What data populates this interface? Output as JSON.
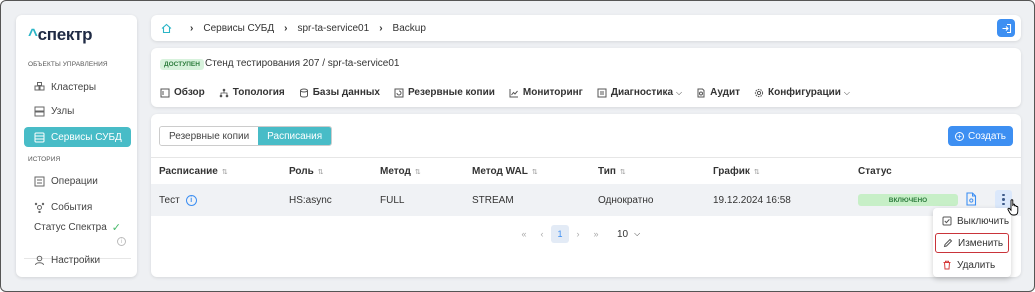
{
  "sidebar": {
    "logo_caret": "^",
    "logo_text": "спектр",
    "section_objects": "ОБЪЕКТЫ УПРАВЛЕНИЯ",
    "items": [
      {
        "label": "Кластеры",
        "icon": "cluster-icon"
      },
      {
        "label": "Узлы",
        "icon": "server-icon"
      },
      {
        "label": "Сервисы СУБД",
        "icon": "database-service-icon",
        "active": true
      }
    ],
    "section_history": "ИСТОРИЯ",
    "history_items": [
      {
        "label": "Операции",
        "icon": "operations-icon"
      },
      {
        "label": "События",
        "icon": "events-icon"
      }
    ],
    "status_label": "Статус Спектра",
    "settings_label": "Настройки"
  },
  "breadcrumb": {
    "items": [
      "Сервисы СУБД",
      "spr-ta-service01",
      "Backup"
    ]
  },
  "header": {
    "badge": "ДОСТУПЕН",
    "title": "Стенд тестирования 207 / spr-ta-service01",
    "tabs": [
      {
        "label": "Обзор",
        "icon": "overview-icon"
      },
      {
        "label": "Топология",
        "icon": "topology-icon"
      },
      {
        "label": "Базы данных",
        "icon": "database-icon"
      },
      {
        "label": "Резервные копии",
        "icon": "backup-icon"
      },
      {
        "label": "Мониторинг",
        "icon": "monitoring-icon"
      },
      {
        "label": "Диагностика",
        "icon": "diagnostics-icon",
        "dropdown": true
      },
      {
        "label": "Аудит",
        "icon": "audit-icon"
      },
      {
        "label": "Конфигурации",
        "icon": "gear-icon",
        "dropdown": true
      }
    ]
  },
  "main": {
    "segments": [
      "Резервные копии",
      "Расписания"
    ],
    "active_segment": "Расписания",
    "create_label": "Создать",
    "columns": [
      "Расписание",
      "Роль",
      "Метод",
      "Метод WAL",
      "Тип",
      "График",
      "Статус"
    ],
    "rows": [
      {
        "schedule": "Тест",
        "role": "HS:async",
        "method": "FULL",
        "wal_method": "STREAM",
        "type": "Однократно",
        "schedule_time": "19.12.2024 16:58",
        "status": "ВКЛЮЧЕНО"
      }
    ],
    "pagination": {
      "first": "«",
      "prev": "‹",
      "current_page": "1",
      "next": "›",
      "last": "»",
      "page_size": "10"
    }
  },
  "context_menu": {
    "items": [
      {
        "label": "Выключить",
        "icon": "checkbox-icon"
      },
      {
        "label": "Изменить",
        "icon": "pencil-icon",
        "highlighted": true
      },
      {
        "label": "Удалить",
        "icon": "trash-icon"
      }
    ]
  },
  "colors": {
    "accent_teal": "#48bcc7",
    "primary_blue": "#3d8ff2",
    "status_green_bg": "#c7efc7",
    "highlight_red": "#c9343a"
  }
}
